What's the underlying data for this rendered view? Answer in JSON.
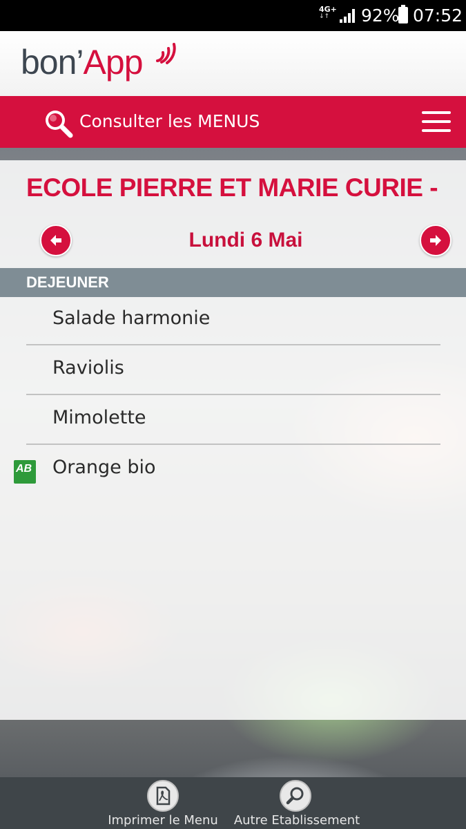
{
  "status_bar": {
    "network": "4G+",
    "battery_percent": "92%",
    "time": "07:52"
  },
  "header": {
    "logo_part1": "bon’",
    "logo_part2": "App"
  },
  "menubar": {
    "label": "Consulter les MENUS",
    "search_icon": "search-icon",
    "menu_icon": "hamburger-icon"
  },
  "school": {
    "title": "ECOLE PIERRE ET MARIE CURIE -"
  },
  "date_nav": {
    "date": "Lundi 6 Mai",
    "prev_icon": "arrow-left-icon",
    "next_icon": "arrow-right-icon"
  },
  "meal": {
    "label": "DEJEUNER",
    "dishes": [
      {
        "name": "Salade harmonie",
        "bio": false
      },
      {
        "name": "Raviolis",
        "bio": false
      },
      {
        "name": "Mimolette",
        "bio": false
      },
      {
        "name": "Orange bio",
        "bio": true,
        "bio_label": "AB"
      }
    ]
  },
  "bottom_bar": {
    "print_label": "Imprimer le Menu",
    "other_label": "Autre Etablissement"
  },
  "colors": {
    "brand_red": "#d5103e",
    "meal_bar": "#7f8d95",
    "bottom_bar": "#3f4549"
  }
}
